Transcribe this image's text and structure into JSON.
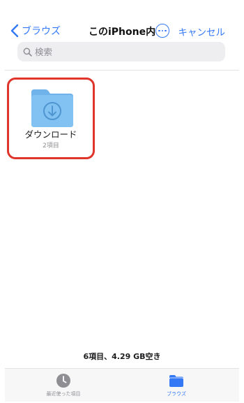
{
  "nav": {
    "back_label": "ブラウズ",
    "title": "このiPhone内",
    "cancel_label": "キャンセル"
  },
  "search": {
    "placeholder": "検索"
  },
  "items": [
    {
      "name": "ダウンロード",
      "meta": "2項目",
      "icon": "download-folder-icon"
    }
  ],
  "summary": "6項目、4.29 GB空き",
  "tabbar": {
    "recent_label": "最近使った項目",
    "browse_label": "ブラウズ"
  },
  "colors": {
    "accent": "#3478f6",
    "folder": "#7cbdf0",
    "highlight": "#e0352b"
  }
}
